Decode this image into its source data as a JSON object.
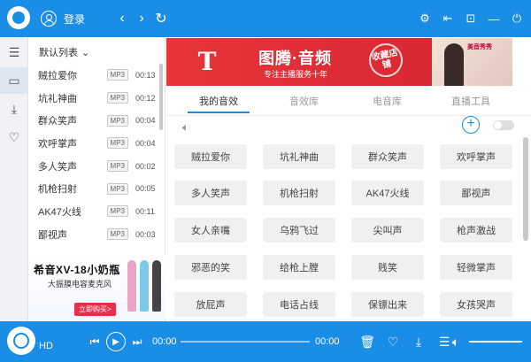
{
  "header": {
    "login_label": "登录",
    "nav": {
      "back": "‹",
      "forward": "›",
      "refresh": "↻"
    },
    "window_icons": [
      "settings-icon",
      "exit-icon",
      "skin-icon",
      "minimize-icon",
      "close-icon"
    ]
  },
  "sidebar_icons": [
    "list-icon",
    "monitor-icon",
    "download-icon",
    "heart-icon"
  ],
  "playlist": {
    "header": "默认列表",
    "items": [
      {
        "name": "贼拉爱你",
        "tag": "MP3",
        "time": "00:13"
      },
      {
        "name": "坑礼神曲",
        "tag": "MP3",
        "time": "00:12"
      },
      {
        "name": "群众笑声",
        "tag": "MP3",
        "time": "00:04"
      },
      {
        "name": "欢呼掌声",
        "tag": "MP3",
        "time": "00:04"
      },
      {
        "name": "多人笑声",
        "tag": "MP3",
        "time": "00:02"
      },
      {
        "name": "机枪扫射",
        "tag": "MP3",
        "time": "00:05"
      },
      {
        "name": "AK47火线",
        "tag": "MP3",
        "time": "00:11"
      },
      {
        "name": "鄙视声",
        "tag": "MP3",
        "time": "00:03"
      }
    ]
  },
  "left_ad": {
    "title": "希音XV-18小奶瓶",
    "subtitle": "大振膜电容麦克风",
    "cta": "立即购买>"
  },
  "banner": {
    "logo": "T",
    "title": "图腾·音频",
    "subtitle": "专注主播服务十年",
    "stamp": "收藏店铺",
    "caption": "美音秀秀"
  },
  "tabs": [
    {
      "label": "我的音效",
      "active": true
    },
    {
      "label": "音效库",
      "active": false
    },
    {
      "label": "电音库",
      "active": false
    },
    {
      "label": "直播工具",
      "active": false
    }
  ],
  "sound_buttons": [
    "贼拉爱你",
    "坑礼神曲",
    "群众笑声",
    "欢呼掌声",
    "多人笑声",
    "机枪扫射",
    "AK47火线",
    "鄙视声",
    "女人亲嘴",
    "乌鸦飞过",
    "尖叫声",
    "枪声激战",
    "邪恶的笑",
    "给枪上膛",
    "贱笑",
    "轻微掌声",
    "放屁声",
    "电话占线",
    "保镖出来",
    "女孩哭声"
  ],
  "player": {
    "quality": "HD",
    "current_time": "00:00",
    "total_time": "00:00",
    "volume_fraction": 1.0
  },
  "colors": {
    "accent": "#1a8ee6",
    "banner": "#e8353b"
  }
}
